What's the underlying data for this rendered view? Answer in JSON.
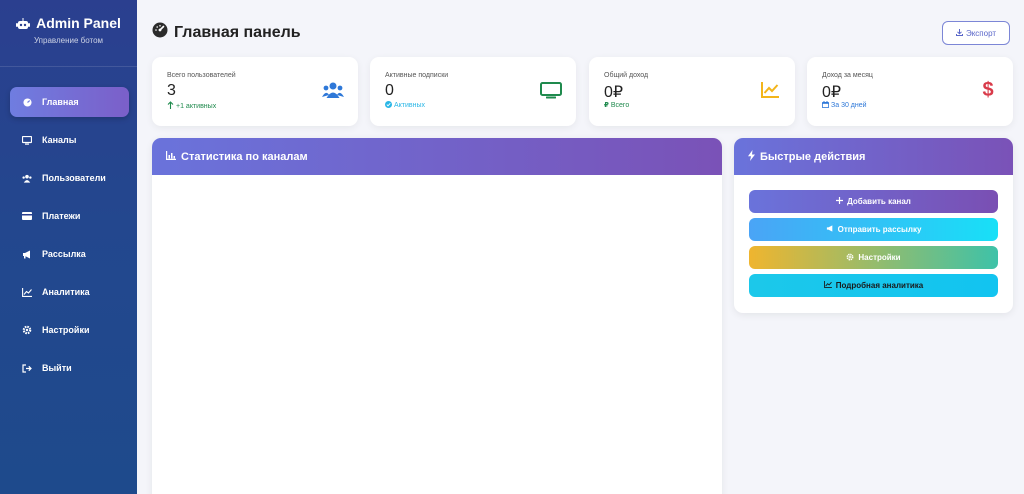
{
  "colors": {
    "sidebar_top": "#2b3f8f",
    "sidebar_bottom": "#1e4a8c",
    "accent_gradient_start": "#6a73db",
    "accent_gradient_end": "#7a52b7",
    "users_icon": "#2e78d8",
    "subs_icon": "#1f8a4d",
    "income_icon": "#f3b51b",
    "monthly_icon": "#d93b4a",
    "positive": "#1f8a4d",
    "info": "#29b6e6"
  },
  "sidebar": {
    "brand_title": "Admin Panel",
    "brand_subtitle": "Управление ботом",
    "brand_icon": "robot-icon",
    "items": [
      {
        "label": "Главная",
        "icon": "dashboard-icon",
        "active": true
      },
      {
        "label": "Каналы",
        "icon": "tv-icon",
        "active": false
      },
      {
        "label": "Пользователи",
        "icon": "users-icon",
        "active": false
      },
      {
        "label": "Платежи",
        "icon": "credit-card-icon",
        "active": false
      },
      {
        "label": "Рассылка",
        "icon": "megaphone-icon",
        "active": false
      },
      {
        "label": "Аналитика",
        "icon": "chart-line-icon",
        "active": false
      },
      {
        "label": "Настройки",
        "icon": "gear-icon",
        "active": false
      },
      {
        "label": "Выйти",
        "icon": "sign-out-icon",
        "active": false
      }
    ]
  },
  "header": {
    "title": "Главная панель",
    "title_icon": "gauge-icon",
    "export_label": "Экспорт",
    "export_icon": "download-icon"
  },
  "stats": [
    {
      "label": "Всего пользователей",
      "value": "3",
      "sub": "+1 активных",
      "sub_icon": "arrow-up-icon",
      "icon": "users-icon"
    },
    {
      "label": "Активные подписки",
      "value": "0",
      "sub": "Активных",
      "sub_icon": "check-circle-icon",
      "icon": "tv-icon"
    },
    {
      "label": "Общий доход",
      "value": "0₽",
      "sub": "Всего",
      "sub_icon": "ruble-icon",
      "icon": "chart-line-icon"
    },
    {
      "label": "Доход за месяц",
      "value": "0₽",
      "sub": "За 30 дней",
      "sub_icon": "calendar-icon",
      "icon": "dollar-icon"
    }
  ],
  "channels_panel": {
    "title": "Статистика по каналам",
    "icon": "chart-area-icon"
  },
  "quick_actions": {
    "title": "Быстрые действия",
    "icon": "bolt-icon",
    "buttons": [
      {
        "label": "Добавить канал",
        "icon": "plus-icon"
      },
      {
        "label": "Отправить рассылку",
        "icon": "megaphone-icon"
      },
      {
        "label": "Настройки",
        "icon": "gear-icon"
      },
      {
        "label": "Подробная аналитика",
        "icon": "chart-line-icon"
      }
    ]
  }
}
